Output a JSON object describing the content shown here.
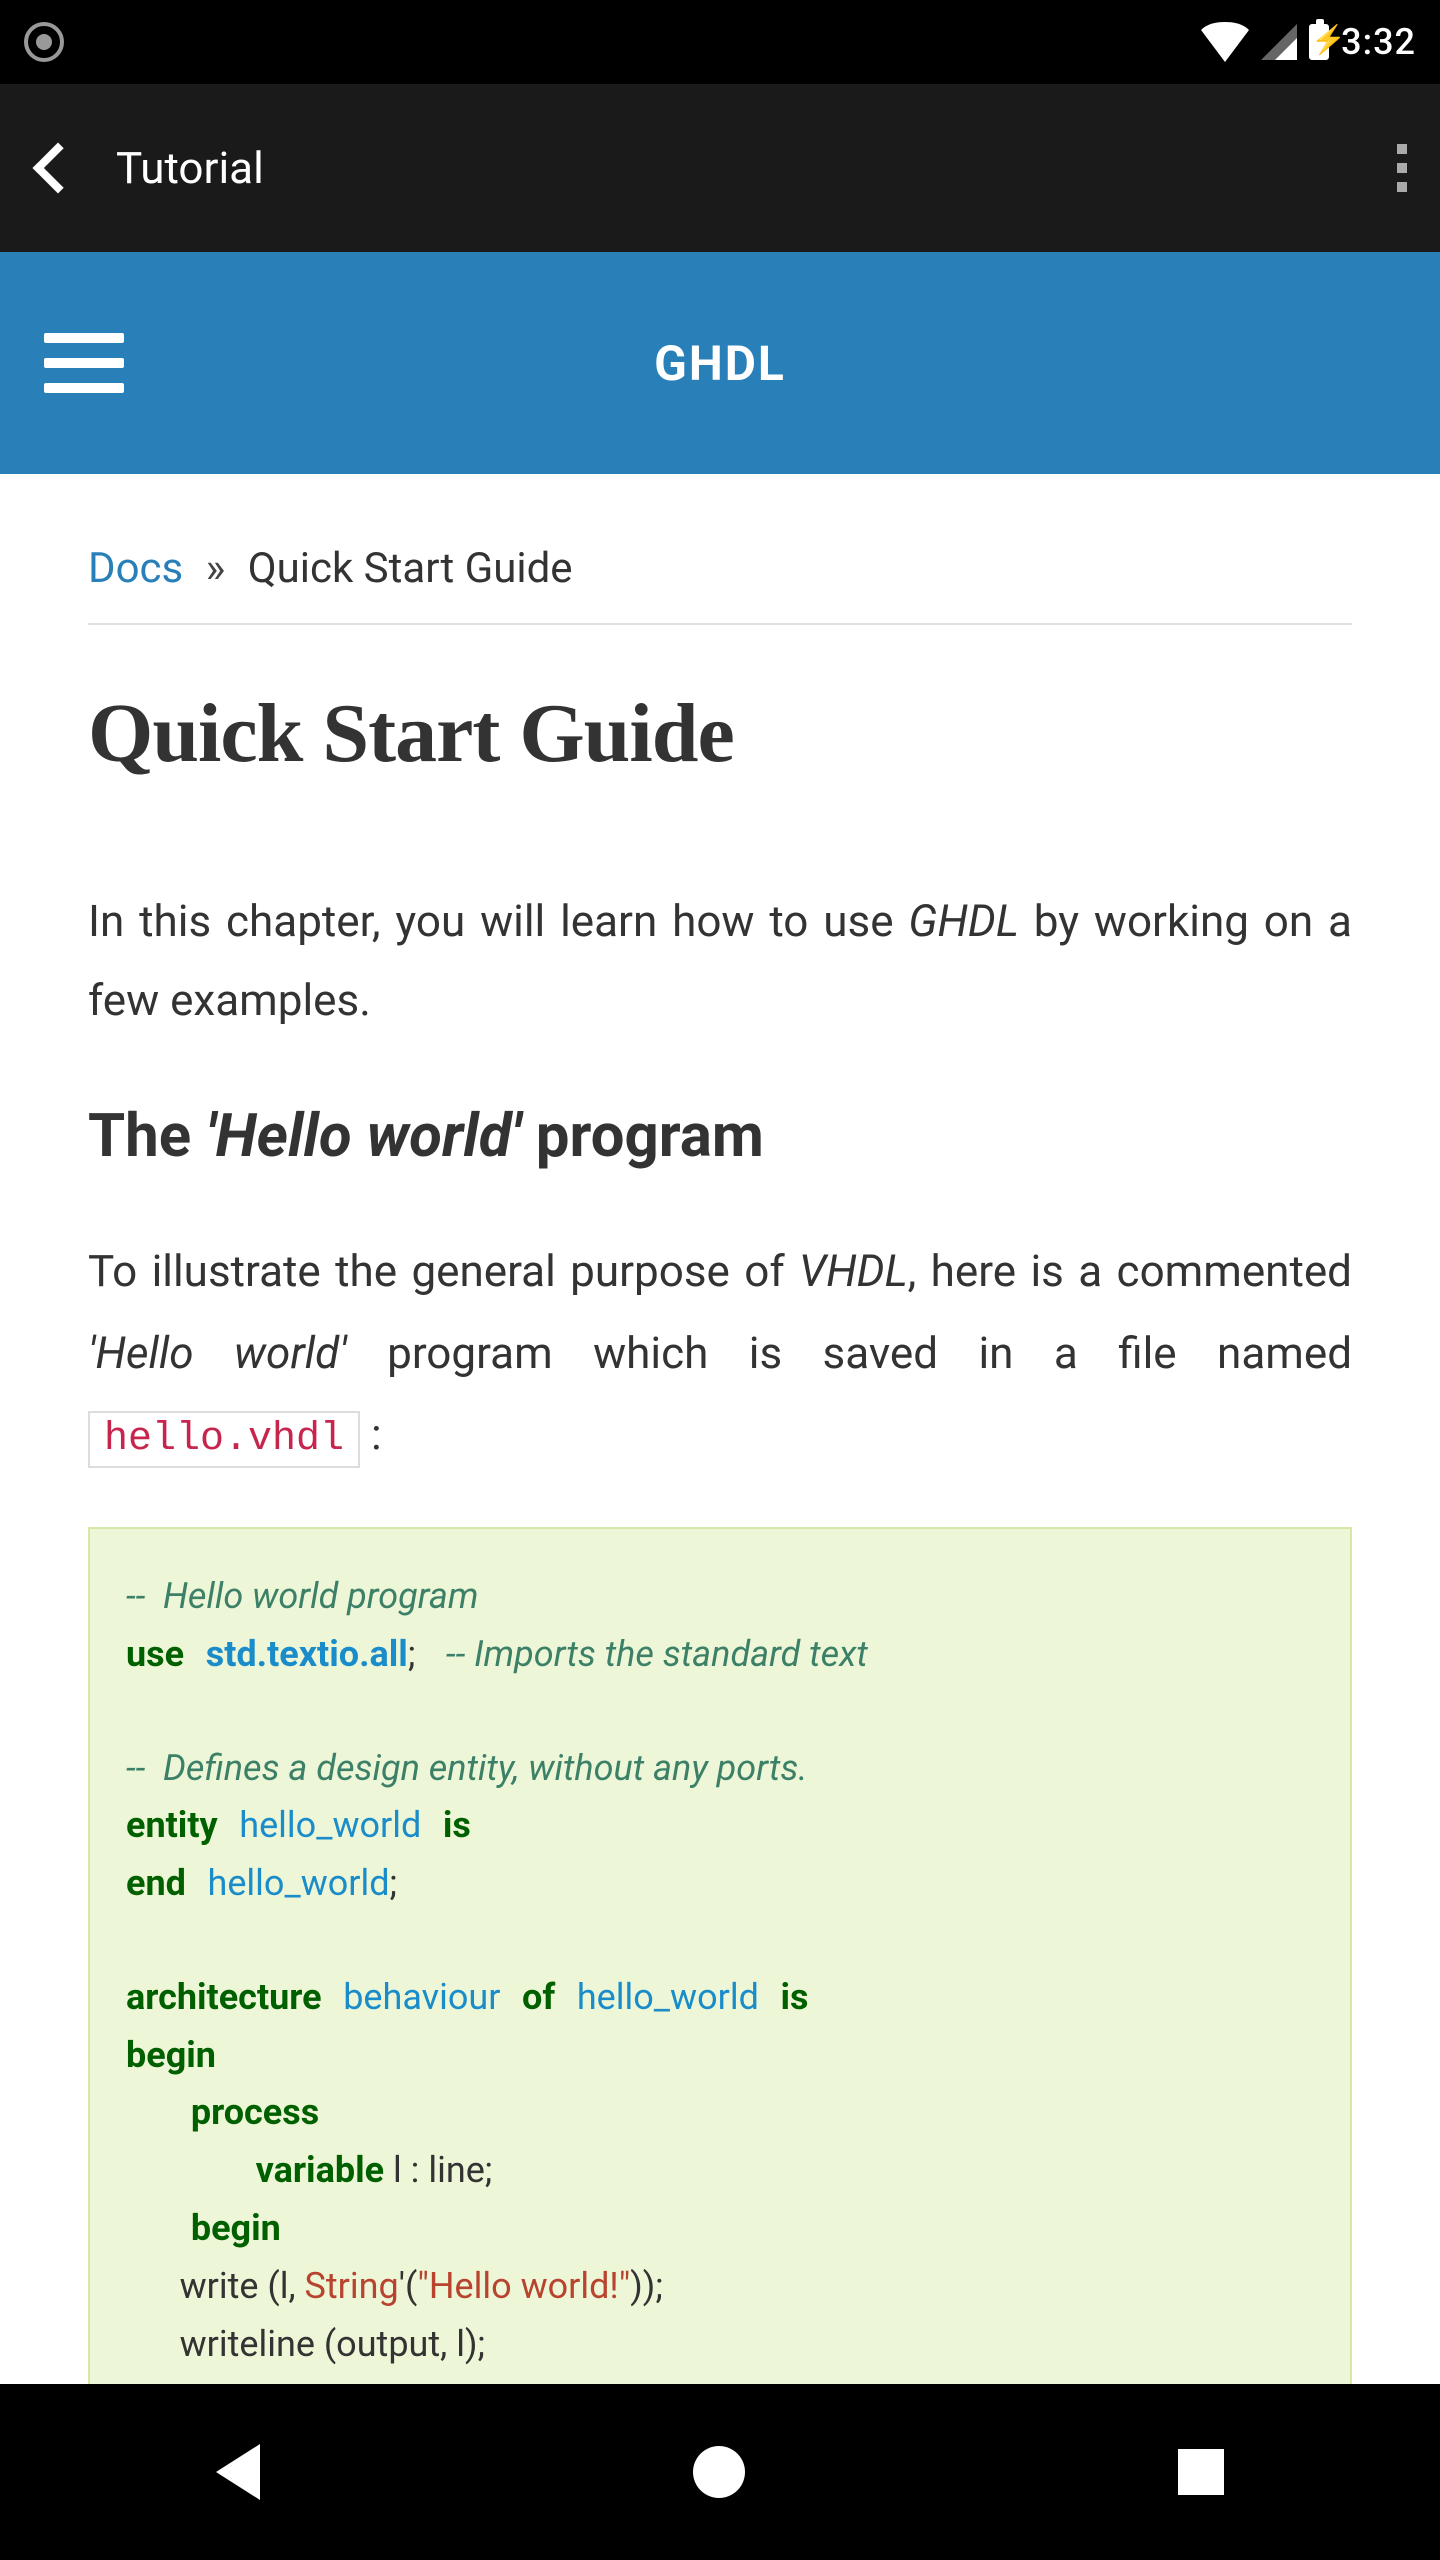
{
  "statusbar": {
    "time": "3:32"
  },
  "appbar": {
    "title": "Tutorial"
  },
  "docheader": {
    "title": "GHDL"
  },
  "breadcrumb": {
    "link": "Docs",
    "separator": "»",
    "current": "Quick Start Guide"
  },
  "content": {
    "h1": "Quick Start Guide",
    "intro_pre": "In this chapter, you will learn how to use ",
    "intro_em": "GHDL",
    "intro_post": " by working on a few examples.",
    "h2_pre": "The ",
    "h2_em": "'Hello world'",
    "h2_post": " program",
    "p2_pre": "To illustrate the general purpose of ",
    "p2_em1": "VHDL",
    "p2_mid1": ", here is a commented ",
    "p2_em2": "'Hello world'",
    "p2_mid2": " program which is saved in a file named ",
    "p2_code": "hello.vhdl",
    "p2_post": " :",
    "code": {
      "c1": "--  Hello world program",
      "l2_kw": "use",
      "l2_nm": "std.textio.all",
      "l2_p": ";",
      "l2_cm": " -- Imports the standard text",
      "c3": "--  Defines a design entity, without any ports.",
      "l4_kw1": "entity",
      "l4_nm": "hello_world",
      "l4_kw2": "is",
      "l5_kw": "end",
      "l5_nm": "hello_world",
      "l5_p": ";",
      "l6_kw1": "architecture",
      "l6_nm1": "behaviour",
      "l6_kw2": "of",
      "l6_nm2": "hello_world",
      "l6_kw3": "is",
      "l7_kw": "begin",
      "l8_kw": "process",
      "l9_kw": "variable",
      "l9_rest": " l : line;",
      "l10_kw": "begin",
      "l11_pre": "      write (l, ",
      "l11_ty": "String",
      "l11_mid": "'(",
      "l11_st": "\"Hello world!\"",
      "l11_post": "));",
      "l12": "      writeline (output, l);"
    }
  }
}
